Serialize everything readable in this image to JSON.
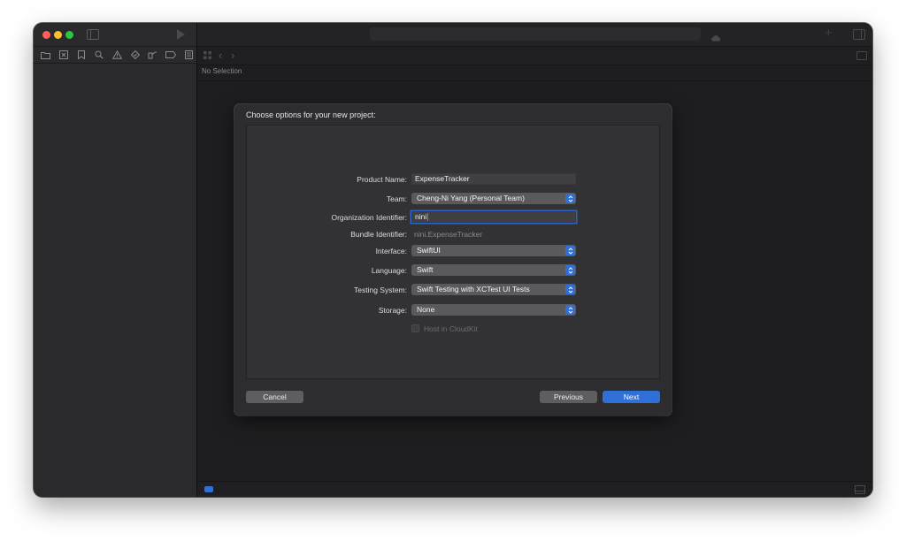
{
  "workspace": {
    "no_selection": "No Selection"
  },
  "icons": {
    "traffic_lights": [
      "close",
      "minimize",
      "zoom"
    ],
    "navigator": [
      "folder-icon",
      "source-control-icon",
      "bookmark-icon",
      "search-icon",
      "warning-icon",
      "test-icon",
      "debug-icon",
      "breakpoint-icon",
      "report-icon"
    ]
  },
  "sheet": {
    "title": "Choose options for your new project:",
    "fields": {
      "product_name": {
        "label": "Product Name:",
        "value": "ExpenseTracker"
      },
      "team": {
        "label": "Team:",
        "value": "Cheng-Ni Yang (Personal Team)"
      },
      "organization_identifier": {
        "label": "Organization Identifier:",
        "value": "nini"
      },
      "bundle_identifier": {
        "label": "Bundle Identifier:",
        "value": "nini.ExpenseTracker"
      },
      "interface": {
        "label": "Interface:",
        "value": "SwiftUI"
      },
      "language": {
        "label": "Language:",
        "value": "Swift"
      },
      "testing_system": {
        "label": "Testing System:",
        "value": "Swift Testing with XCTest UI Tests"
      },
      "storage": {
        "label": "Storage:",
        "value": "None"
      },
      "host_in_cloudkit": {
        "label": "Host in CloudKit",
        "checked": false,
        "enabled": false
      }
    },
    "buttons": {
      "cancel": "Cancel",
      "previous": "Previous",
      "next": "Next"
    }
  },
  "colors": {
    "accent": "#2f6fd6",
    "window_bg": "#1e1e20",
    "sheet_bg": "#2d2d2f"
  }
}
